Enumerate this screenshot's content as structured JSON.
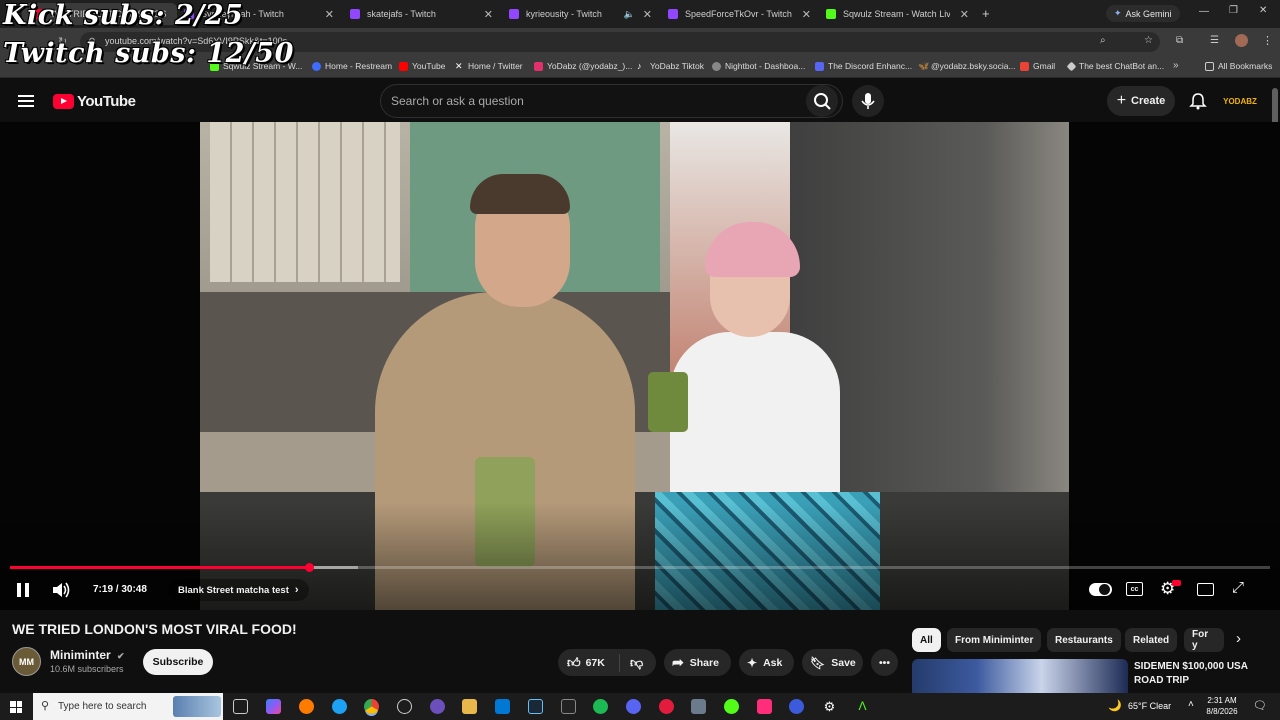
{
  "overlay": {
    "kick": "Kick subs: 2/25",
    "twitch": "Twitch subs: 12/50"
  },
  "browser": {
    "tabs": [
      {
        "label": "WE TRIED LONDON'S MOS",
        "active": true,
        "color": "#ff0033"
      },
      {
        "label": "SydneyMiah - Twitch",
        "color": "#9146ff"
      },
      {
        "label": "skatejafs - Twitch",
        "color": "#9146ff"
      },
      {
        "label": "kyrieousity - Twitch",
        "color": "#9146ff"
      },
      {
        "label": "SpeedForceTkOvr - Twitch",
        "color": "#9146ff"
      },
      {
        "label": "Sqwulz Stream - Watch Live on",
        "color": "#53fc18"
      }
    ],
    "new_tab": "+",
    "gemini": "Ask Gemini",
    "url": "youtube.com/watch?v=Sd6YVI9PSkk&t=100s",
    "bookmarks": [
      {
        "label": "Sqwulz Stream - W...",
        "color": "#53fc18"
      },
      {
        "label": "Home - Restream",
        "color": "#3d6cff"
      },
      {
        "label": "YouTube",
        "color": "#ff0000"
      },
      {
        "label": "Home / Twitter",
        "color": "#ffffff"
      },
      {
        "label": "YoDabz (@yodabz_)...",
        "color": "#e1306c"
      },
      {
        "label": "YoDabz Tiktok",
        "color": "#ffffff"
      },
      {
        "label": "Nightbot - Dashboa...",
        "color": "#888888"
      },
      {
        "label": "The Discord Enhanc...",
        "color": "#5865f2"
      },
      {
        "label": "@yodabz.bsky.socia...",
        "color": "#1185fe"
      },
      {
        "label": "Gmail",
        "color": "#ea4335"
      },
      {
        "label": "The best ChatBot an...",
        "color": "#cccccc"
      }
    ],
    "all_bookmarks": "All Bookmarks"
  },
  "youtube": {
    "logo_text": "YouTube",
    "search_placeholder": "Search or ask a question",
    "create_label": "Create",
    "user_avatar": "YODABZ",
    "player": {
      "time": "7:19 / 30:48",
      "progress_fraction": 0.2375,
      "buffered_fraction": 0.276,
      "chapter": "Blank Street matcha test"
    },
    "video": {
      "title": "WE TRIED LONDON'S MOST VIRAL FOOD!",
      "channel": "Miniminter",
      "subscribers": "10.6M subscribers",
      "subscribe_label": "Subscribe",
      "avatar_text": "MM",
      "likes": "67K",
      "share_label": "Share",
      "ask_label": "Ask",
      "save_label": "Save"
    },
    "chips": [
      "All",
      "From Miniminter",
      "Restaurants",
      "Related",
      "For y"
    ],
    "related": {
      "title": "SIDEMEN $100,000 USA ROAD TRIP"
    }
  },
  "taskbar": {
    "search_placeholder": "Type here to search",
    "weather": "65°F  Clear",
    "time": "2:31 AM",
    "date": "8/8/2026"
  }
}
